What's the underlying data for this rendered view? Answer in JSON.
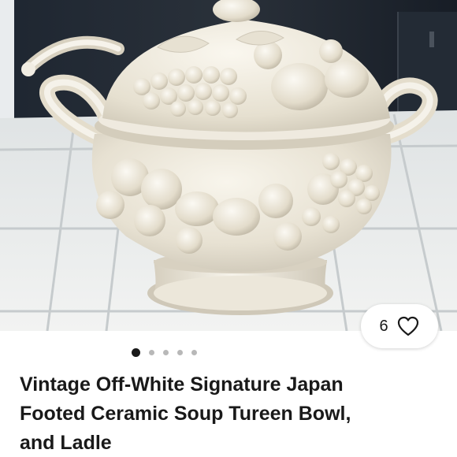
{
  "listing": {
    "title_line1": "Vintage Off-White Signature Japan",
    "title_line2": "Footed Ceramic Soup Tureen Bowl,",
    "title_line3": "and Ladle"
  },
  "gallery": {
    "image_icon": "soup-tureen-photo",
    "dot_count": 5,
    "active_index": 0
  },
  "like": {
    "count": "6",
    "icon": "heart-outline-icon"
  },
  "colors": {
    "text": "#191919",
    "dot_inactive": "#b8b8b8",
    "dot_active": "#191919",
    "ceramic": "#ece7da"
  }
}
